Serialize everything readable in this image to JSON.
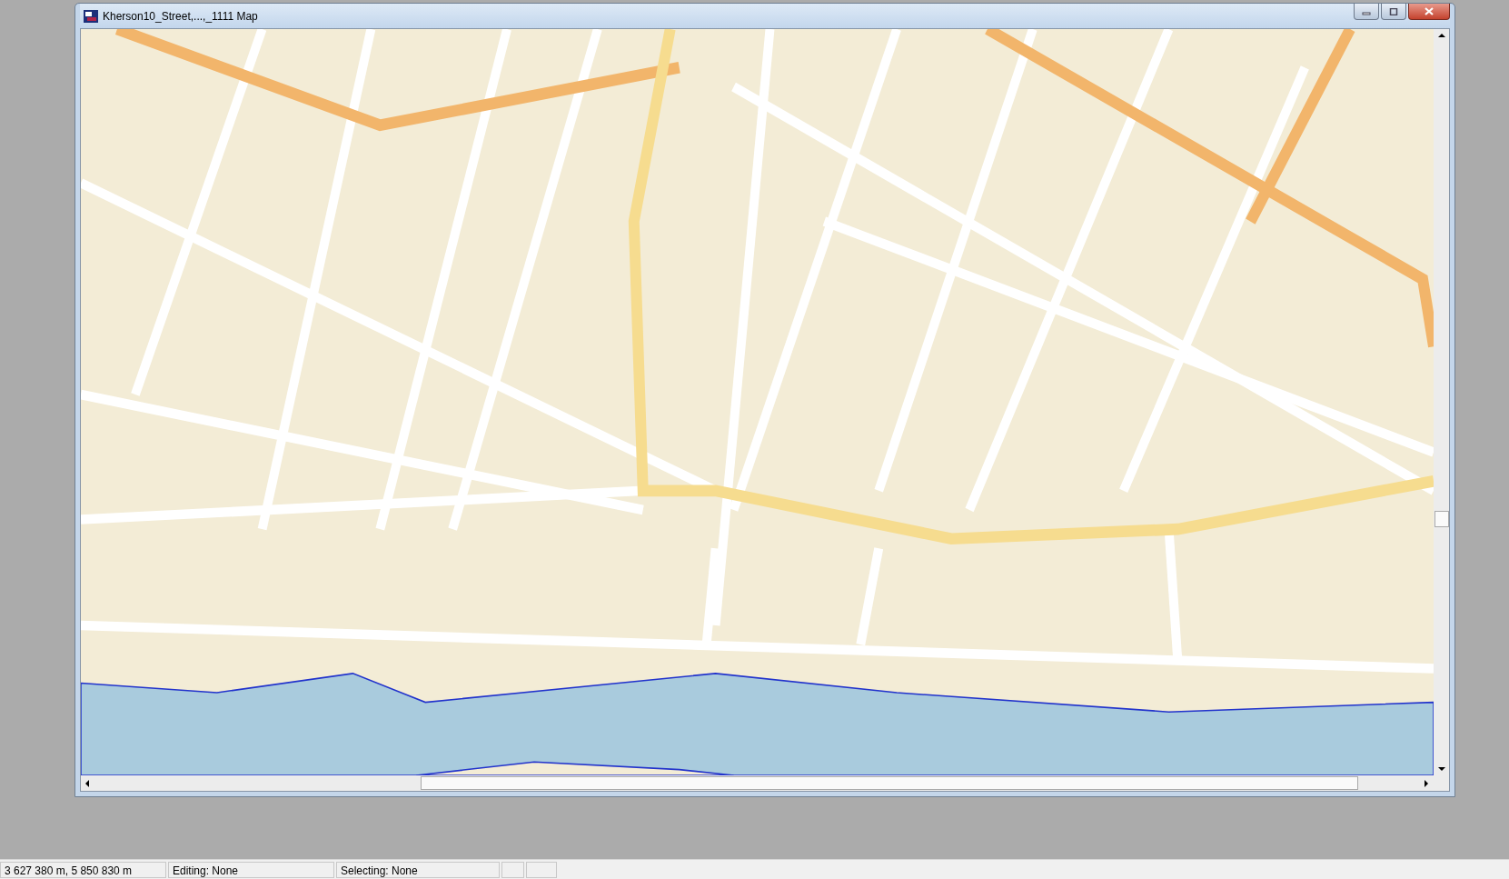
{
  "window": {
    "title": "Kherson10_Street,...,_1111 Map"
  },
  "status_bar": {
    "fields": [
      "3 627 380 m, 5 850 830 m",
      "Editing: None",
      "Selecting: None"
    ]
  }
}
